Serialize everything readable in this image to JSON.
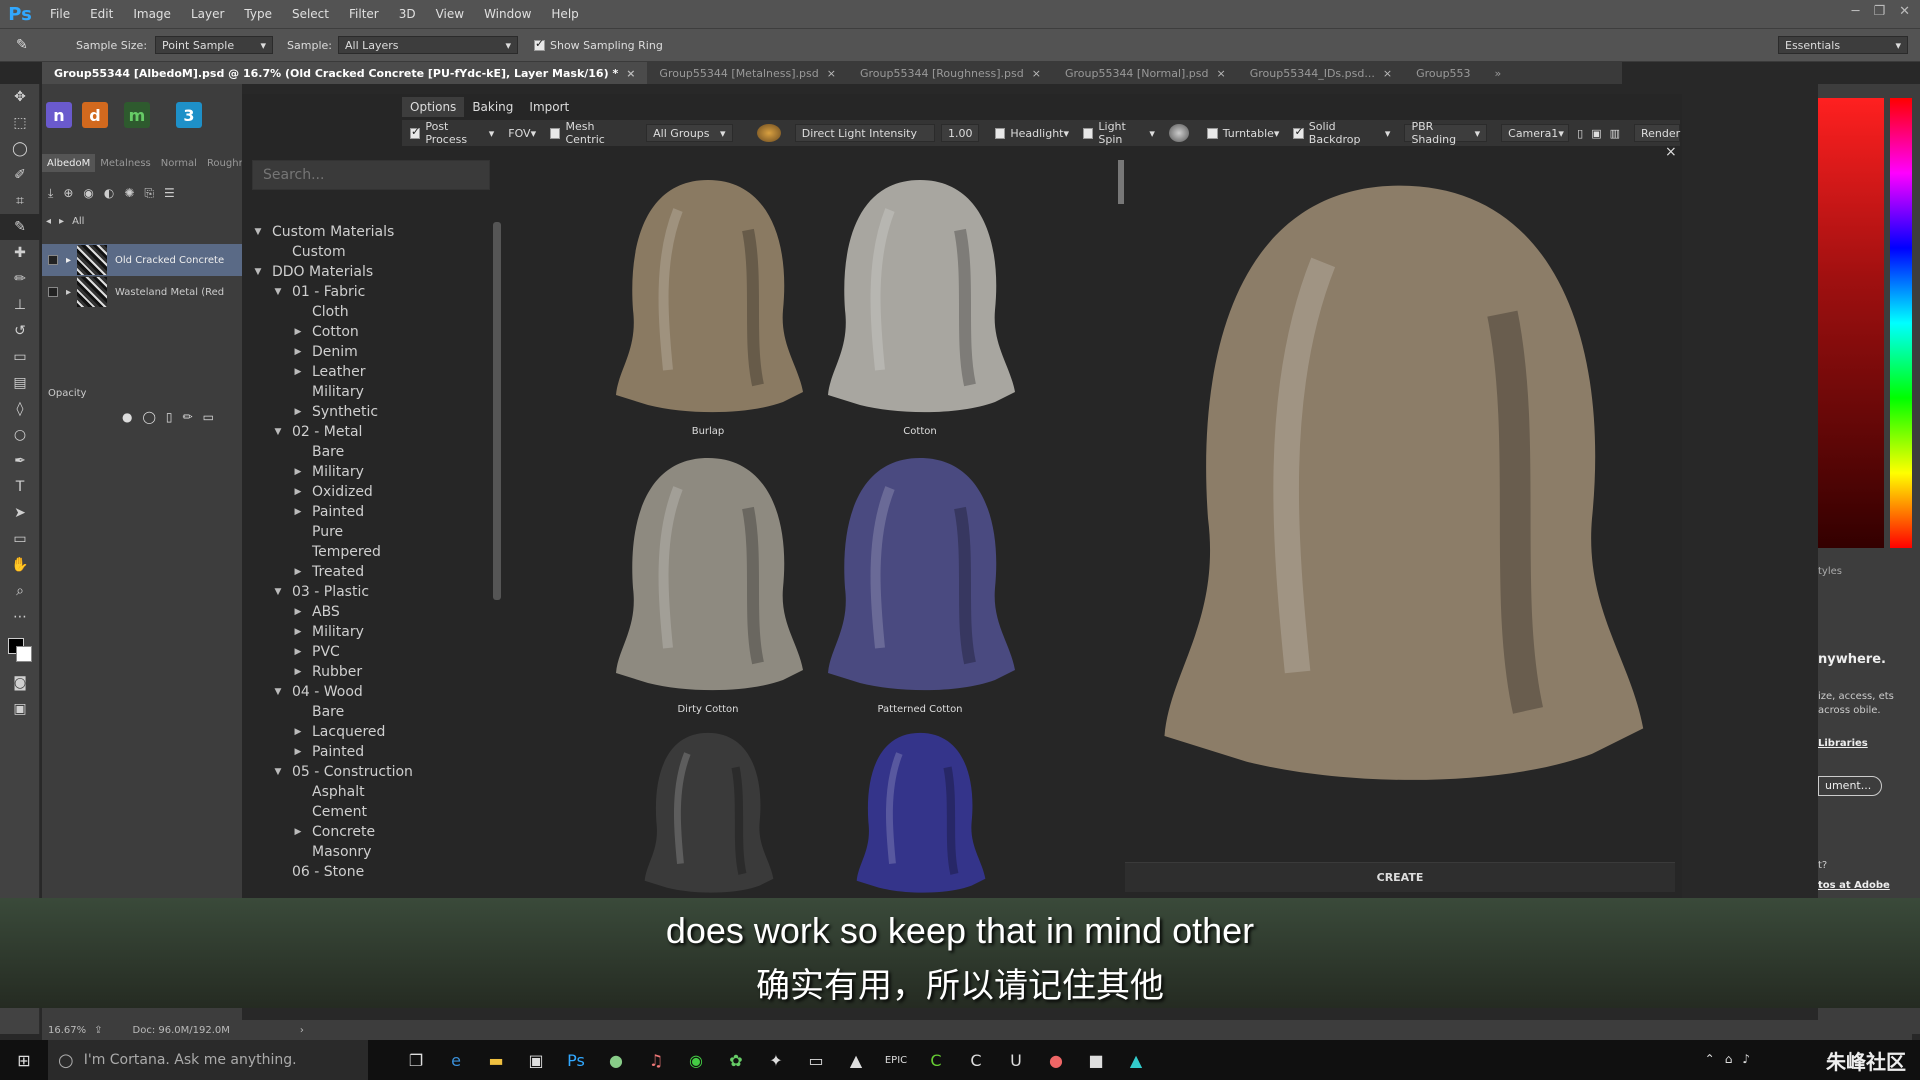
{
  "app": {
    "logo": "Ps"
  },
  "menubar": {
    "items": [
      "File",
      "Edit",
      "Image",
      "Layer",
      "Type",
      "Select",
      "Filter",
      "3D",
      "View",
      "Window",
      "Help"
    ]
  },
  "window_controls": {
    "minimize": "─",
    "restore": "❐",
    "close": "✕"
  },
  "optionsbar": {
    "sample_size_label": "Sample Size:",
    "sample_size_value": "Point Sample",
    "sample_label": "Sample:",
    "sample_value": "All Layers",
    "show_sampling_ring": "Show Sampling Ring",
    "workspace": "Essentials"
  },
  "doc_tabs": [
    {
      "label": "Group55344 [AlbedoM].psd @ 16.7% (Old Cracked Concrete [PU-fYdc-kE], Layer Mask/16) *",
      "active": true
    },
    {
      "label": "Group55344 [Metalness].psd",
      "active": false
    },
    {
      "label": "Group55344 [Roughness].psd",
      "active": false
    },
    {
      "label": "Group55344 [Normal].psd",
      "active": false
    },
    {
      "label": "Group55344_IDs.psd...",
      "active": false
    },
    {
      "label": "Group553",
      "active": false
    }
  ],
  "doc_tabs_overflow": "»",
  "tab_close": "×",
  "left_panel": {
    "channel_tabs": [
      "AlbedoM",
      "Metalness",
      "Normal",
      "Roughne"
    ],
    "filter_label": "All",
    "layers": [
      {
        "name": "Old Cracked Concrete",
        "selected": true
      },
      {
        "name": "Wasteland Metal (Red",
        "selected": false
      }
    ],
    "opacity_label": "Opacity"
  },
  "dialog": {
    "tabs": [
      "Options",
      "Baking",
      "Import"
    ],
    "options": {
      "post_process": "Post Process",
      "fov": "FOV",
      "mesh_centric": "Mesh Centric",
      "groups": "All Groups",
      "light_label": "Direct Light Intensity",
      "light_value": "1.00",
      "headlight": "Headlight",
      "light_spin": "Light Spin",
      "turntable": "Turntable",
      "solid_backdrop": "Solid Backdrop",
      "shading": "PBR Shading",
      "camera": "Camera1",
      "render": "Render"
    },
    "search_placeholder": "Search...",
    "close": "×",
    "create_button": "CREATE"
  },
  "tree": [
    {
      "label": "Custom Materials",
      "level": 0,
      "caret": "open"
    },
    {
      "label": "Custom",
      "level": 1,
      "caret": "none"
    },
    {
      "label": "DDO Materials",
      "level": 0,
      "caret": "open"
    },
    {
      "label": "01 - Fabric",
      "level": 1,
      "caret": "open"
    },
    {
      "label": "Cloth",
      "level": 2,
      "caret": "none"
    },
    {
      "label": "Cotton",
      "level": 2,
      "caret": "closed"
    },
    {
      "label": "Denim",
      "level": 2,
      "caret": "closed"
    },
    {
      "label": "Leather",
      "level": 2,
      "caret": "closed"
    },
    {
      "label": "Military",
      "level": 2,
      "caret": "none"
    },
    {
      "label": "Synthetic",
      "level": 2,
      "caret": "closed"
    },
    {
      "label": "02 - Metal",
      "level": 1,
      "caret": "open"
    },
    {
      "label": "Bare",
      "level": 2,
      "caret": "none"
    },
    {
      "label": "Military",
      "level": 2,
      "caret": "closed"
    },
    {
      "label": "Oxidized",
      "level": 2,
      "caret": "closed"
    },
    {
      "label": "Painted",
      "level": 2,
      "caret": "closed"
    },
    {
      "label": "Pure",
      "level": 2,
      "caret": "none"
    },
    {
      "label": "Tempered",
      "level": 2,
      "caret": "none"
    },
    {
      "label": "Treated",
      "level": 2,
      "caret": "closed"
    },
    {
      "label": "03 - Plastic",
      "level": 1,
      "caret": "open"
    },
    {
      "label": "ABS",
      "level": 2,
      "caret": "closed"
    },
    {
      "label": "Military",
      "level": 2,
      "caret": "closed"
    },
    {
      "label": "PVC",
      "level": 2,
      "caret": "closed"
    },
    {
      "label": "Rubber",
      "level": 2,
      "caret": "closed"
    },
    {
      "label": "04 - Wood",
      "level": 1,
      "caret": "open"
    },
    {
      "label": "Bare",
      "level": 2,
      "caret": "none"
    },
    {
      "label": "Lacquered",
      "level": 2,
      "caret": "closed"
    },
    {
      "label": "Painted",
      "level": 2,
      "caret": "closed"
    },
    {
      "label": "05 - Construction",
      "level": 1,
      "caret": "open"
    },
    {
      "label": "Asphalt",
      "level": 2,
      "caret": "none"
    },
    {
      "label": "Cement",
      "level": 2,
      "caret": "none"
    },
    {
      "label": "Concrete",
      "level": 2,
      "caret": "closed"
    },
    {
      "label": "Masonry",
      "level": 2,
      "caret": "none"
    },
    {
      "label": "06 - Stone",
      "level": 1,
      "caret": "none"
    }
  ],
  "materials": [
    {
      "label": "Burlap",
      "color": "#8a7a62"
    },
    {
      "label": "Cotton",
      "color": "#a8a6a0"
    },
    {
      "label": "Dirty Cotton",
      "color": "#8e8a80"
    },
    {
      "label": "Patterned Cotton",
      "color": "#4a4a80"
    },
    {
      "label": "",
      "color": "#3a3a3a"
    },
    {
      "label": "",
      "color": "#34348a"
    }
  ],
  "preview": {
    "color": "#8c7d68"
  },
  "right_panel": {
    "styles_label": "tyles",
    "headline": "nywhere.",
    "body": "ize, access, ets across obile.",
    "libraries_link": "Libraries",
    "document_button": "ument...",
    "question": "t?",
    "adobe_link": "tos at Adobe"
  },
  "statusbar": {
    "zoom": "16.67%",
    "doc": "Doc: 96.0M/192.0M"
  },
  "subtitle": {
    "en": "does work so keep that in mind other",
    "zh": "确实有用，所以请记住其他"
  },
  "taskbar": {
    "cortana": "I'm Cortana. Ask me anything.",
    "watermark": "朱峰社区"
  }
}
